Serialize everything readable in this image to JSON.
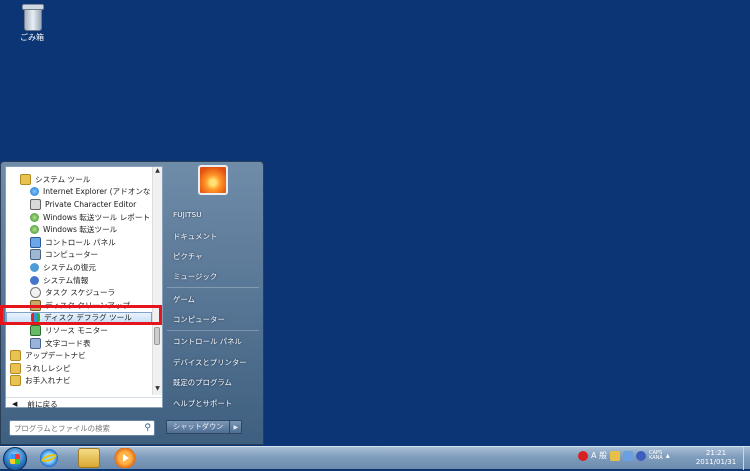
{
  "desktop": {
    "recycle_bin_label": "ごみ箱"
  },
  "start_menu": {
    "programs": [
      {
        "label": "システム ツール",
        "icon": "folder-icon",
        "indent": 1,
        "cls": "ic-folder"
      },
      {
        "label": "Internet Explorer (アドオンなし)",
        "icon": "internet-explorer-icon",
        "indent": 2,
        "cls": "ic-ie"
      },
      {
        "label": "Private Character Editor",
        "icon": "pen-icon",
        "indent": 2,
        "cls": "ic-pen"
      },
      {
        "label": "Windows 転送ツール レポート",
        "icon": "transfer-icon",
        "indent": 2,
        "cls": "ic-net"
      },
      {
        "label": "Windows 転送ツール",
        "icon": "transfer-icon",
        "indent": 2,
        "cls": "ic-net"
      },
      {
        "label": "コントロール パネル",
        "icon": "control-panel-icon",
        "indent": 2,
        "cls": "ic-cp"
      },
      {
        "label": "コンピューター",
        "icon": "computer-icon",
        "indent": 2,
        "cls": "ic-pc"
      },
      {
        "label": "システムの復元",
        "icon": "system-restore-icon",
        "indent": 2,
        "cls": "ic-restore"
      },
      {
        "label": "システム情報",
        "icon": "info-icon",
        "indent": 2,
        "cls": "ic-info"
      },
      {
        "label": "タスク スケジューラ",
        "icon": "clock-icon",
        "indent": 2,
        "cls": "ic-clock"
      },
      {
        "label": "ディスク クリーンアップ",
        "icon": "disk-cleanup-icon",
        "indent": 2,
        "cls": "ic-clean"
      },
      {
        "label": "ディスク デフラグ ツール",
        "icon": "defrag-icon",
        "indent": 2,
        "cls": "ic-defrag",
        "selected": true
      },
      {
        "label": "リソース モニター",
        "icon": "resource-monitor-icon",
        "indent": 2,
        "cls": "ic-res"
      },
      {
        "label": "文字コード表",
        "icon": "character-map-icon",
        "indent": 2,
        "cls": "ic-char"
      },
      {
        "label": "アップデートナビ",
        "icon": "folder-icon",
        "indent": 0,
        "cls": "ic-folder"
      },
      {
        "label": "うれしレシピ",
        "icon": "folder-icon",
        "indent": 0,
        "cls": "ic-folder"
      },
      {
        "label": "お手入れナビ",
        "icon": "folder-icon",
        "indent": 0,
        "cls": "ic-folder"
      }
    ],
    "back_label": "前に戻る",
    "search_placeholder": "プログラムとファイルの検索",
    "right_items": [
      {
        "label": "FUJITSU",
        "name": "start-item-user"
      },
      {
        "label": "ドキュメント",
        "name": "start-item-documents"
      },
      {
        "label": "ピクチャ",
        "name": "start-item-pictures"
      },
      {
        "label": "ミュージック",
        "name": "start-item-music"
      },
      {
        "label": "ゲーム",
        "name": "start-item-games"
      },
      {
        "label": "コンピューター",
        "name": "start-item-computer"
      },
      {
        "label": "コントロール パネル",
        "name": "start-item-control-panel"
      },
      {
        "label": "デバイスとプリンター",
        "name": "start-item-devices-printers"
      },
      {
        "label": "既定のプログラム",
        "name": "start-item-default-programs"
      },
      {
        "label": "ヘルプとサポート",
        "name": "start-item-help-support"
      }
    ],
    "shutdown_label": "シャットダウン"
  },
  "taskbar": {
    "tray_ime": "A 般",
    "tray_caps": "CAPS",
    "tray_kana": "KANA",
    "clock_time": "21:21",
    "clock_date": "2011/01/31"
  }
}
